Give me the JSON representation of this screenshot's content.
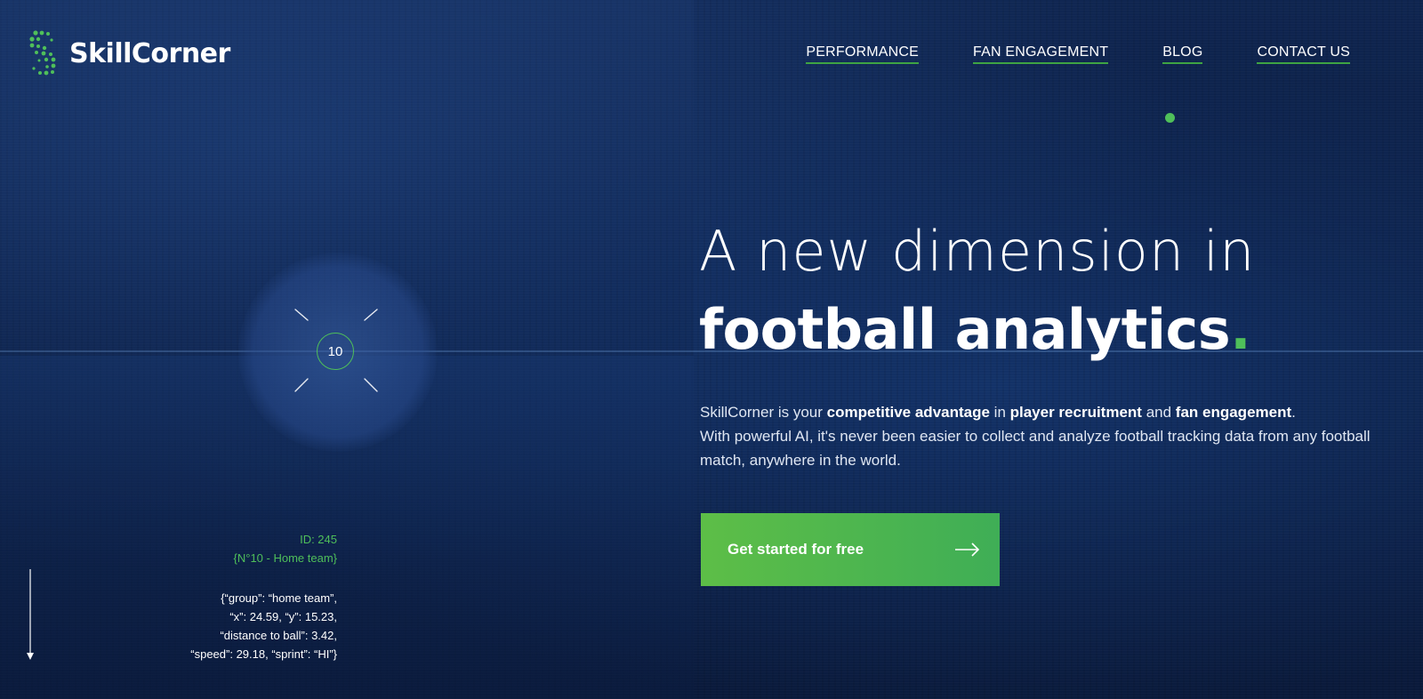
{
  "brand": {
    "name": "SkillCorner",
    "accent": "#4fbf5a"
  },
  "nav": {
    "items": [
      {
        "label": "PERFORMANCE"
      },
      {
        "label": "FAN ENGAGEMENT"
      },
      {
        "label": "BLOG"
      },
      {
        "label": "CONTACT US"
      }
    ]
  },
  "tracker": {
    "player_number": "10",
    "id_text": "ID: 245",
    "team_text": "{N°10 - Home team}",
    "json_lines": [
      "{“group”: “home team”,",
      "“x”: 24.59, “y”: 15.23,",
      "“distance to ball”: 3.42,",
      "“speed”: 29.18, “sprint”: “HI”}"
    ]
  },
  "hero": {
    "headline_line1": "A new dimension in",
    "headline_line2": "football analytics",
    "headline_dot": ".",
    "intro": {
      "p1_a": "SkillCorner is your ",
      "p1_b": "competitive advantage",
      "p1_c": " in ",
      "p1_d": "player recruitment",
      "p1_e": " and ",
      "p1_f": "fan engagement",
      "p1_g": ".",
      "p2": "With powerful AI, it's never been easier to collect and analyze football tracking data from any football match, anywhere in the world."
    },
    "cta": {
      "label": "Get started for free",
      "icon": "arrow-right-icon"
    }
  },
  "icons": {
    "scroll": "arrow-down-icon",
    "logo": "skillcorner-logo-mark"
  }
}
